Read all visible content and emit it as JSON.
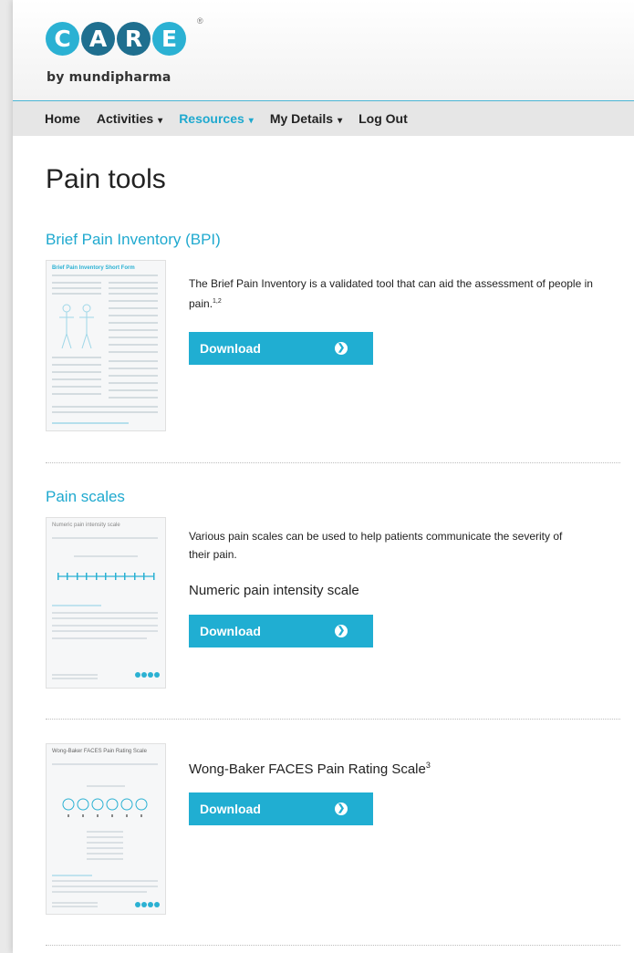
{
  "brand": {
    "letters": [
      "C",
      "A",
      "R",
      "E"
    ],
    "registered": "®",
    "tagline": "by mundipharma",
    "accent_color": "#2bb1d3"
  },
  "nav": {
    "items": [
      {
        "label": "Home",
        "dropdown": false
      },
      {
        "label": "Activities",
        "dropdown": true
      },
      {
        "label": "Resources",
        "dropdown": true,
        "active": true
      },
      {
        "label": "My Details",
        "dropdown": true
      },
      {
        "label": "Log Out",
        "dropdown": false
      }
    ],
    "caret": "▾"
  },
  "page": {
    "title": "Pain tools"
  },
  "sections": {
    "bpi": {
      "title": "Brief Pain Inventory (BPI)",
      "thumb_heading": "Brief Pain Inventory Short Form",
      "description": "The Brief Pain Inventory is a validated tool that can aid the assessment of people in pain.",
      "description_ref": "1,2",
      "button_label": "Download"
    },
    "scales": {
      "title": "Pain scales",
      "thumb_heading": "Numeric pain intensity scale",
      "description": "Various pain scales can be used to help patients communicate the severity of their pain.",
      "subheading": "Numeric pain intensity scale",
      "button_label": "Download"
    },
    "faces": {
      "thumb_heading": "Wong-Baker FACES Pain Rating Scale",
      "subheading": "Wong-Baker FACES Pain Rating Scale",
      "subheading_ref": "3",
      "button_label": "Download"
    }
  },
  "icons": {
    "button_arrow": "arrow-circle-right-icon"
  }
}
